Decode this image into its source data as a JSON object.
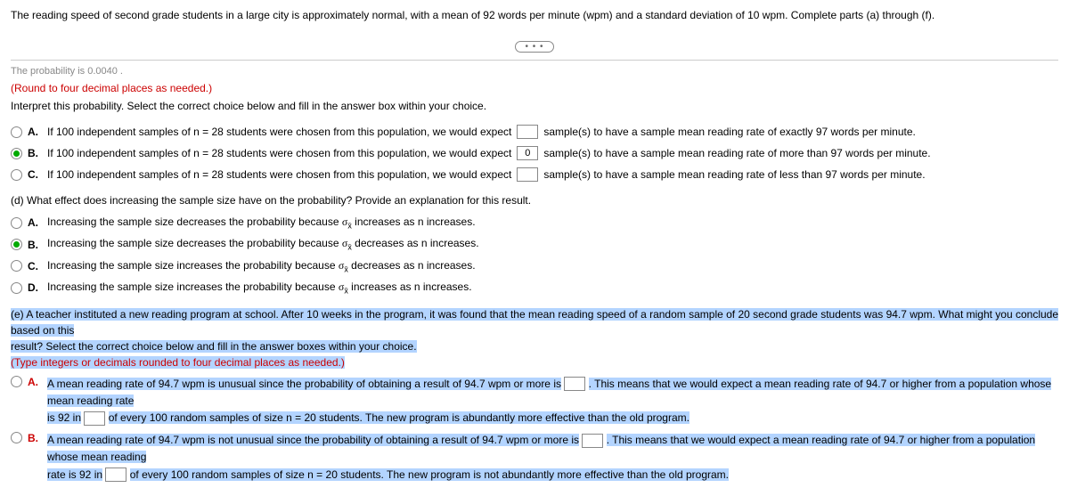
{
  "problem": "The reading speed of second grade students in a large city is approximately normal, with a mean of 92 words per minute (wpm) and a standard deviation of 10 wpm. Complete parts (a) through (f).",
  "more_label": "• • •",
  "cut_text": "The probability is 0.0040 .",
  "round_instruction": "(Round to four decimal places as needed.)",
  "interpret_prompt": "Interpret this probability. Select the correct choice below and fill in the answer box within your choice.",
  "c_choices": {
    "a": {
      "label": "A.",
      "pre": "If 100 independent samples of n = 28 students were chosen from this population, we would expect",
      "post": "sample(s) to have a sample mean reading rate of exactly 97 words per minute."
    },
    "b": {
      "label": "B.",
      "pre": "If 100 independent samples of n = 28 students were chosen from this population, we would expect",
      "val": "0",
      "post": "sample(s) to have a sample mean reading rate of more than 97 words per minute."
    },
    "c": {
      "label": "C.",
      "pre": "If 100 independent samples of n = 28 students were chosen from this population, we would expect",
      "post": "sample(s) to have a sample mean reading rate of less than 97 words per minute."
    }
  },
  "d_prompt": "(d) What effect does increasing the sample size have on the probability? Provide an explanation for this result.",
  "d_choices": {
    "a": {
      "label": "A.",
      "text_pre": "Increasing the sample size decreases the probability because ",
      "text_post": " increases as n increases."
    },
    "b": {
      "label": "B.",
      "text_pre": "Increasing the sample size decreases the probability because ",
      "text_post": " decreases as n increases."
    },
    "c": {
      "label": "C.",
      "text_pre": "Increasing the sample size increases the probability because ",
      "text_post": " decreases as n increases."
    },
    "d": {
      "label": "D.",
      "text_pre": "Increasing the sample size increases the probability because ",
      "text_post": " increases as n increases."
    }
  },
  "sigma": "σ",
  "sigma_sub": "x̄",
  "e_prompt_1": "(e) A teacher instituted a new reading program at school. After 10 weeks in the program, it was found that the mean reading speed of a random sample of 20 second grade students was 94.7 wpm. What might you conclude based on this",
  "e_prompt_2": "result? Select the correct choice below and fill in the answer boxes within your choice.",
  "e_instruction": "(Type integers or decimals rounded to four decimal places as needed.)",
  "e_choices": {
    "a": {
      "label": "A.",
      "p1": "A mean reading rate of 94.7 wpm is unusual since the probability of obtaining a result of 94.7 wpm or more is",
      "p2": ". This means that we would expect a mean reading rate of 94.7 or higher from a population whose mean reading rate",
      "p3": "is 92 in",
      "p4": "of every 100 random samples of size n = 20 students. The new program is abundantly more effective than the old program."
    },
    "b": {
      "label": "B.",
      "p1": "A mean reading rate of 94.7 wpm is not unusual since the probability of obtaining a result of 94.7 wpm or more is",
      "p2": ". This means that we would expect a mean reading rate of 94.7 or higher from a population whose mean reading",
      "p3": "rate is 92 in",
      "p4": "of every 100 random samples of size n = 20 students. The new program is not abundantly more effective than the old program."
    }
  }
}
